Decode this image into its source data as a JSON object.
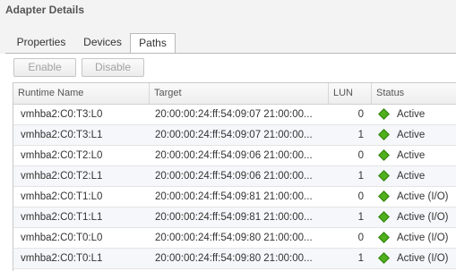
{
  "title": "Adapter Details",
  "tabs": [
    {
      "label": "Properties",
      "active": false
    },
    {
      "label": "Devices",
      "active": false
    },
    {
      "label": "Paths",
      "active": true
    }
  ],
  "toolbar": {
    "enable_label": "Enable",
    "disable_label": "Disable",
    "enabled": false
  },
  "grid": {
    "columns": [
      "Runtime Name",
      "Target",
      "LUN",
      "Status"
    ],
    "rows": [
      {
        "name": "vmhba2:C0:T3:L0",
        "target": "20:00:00:24:ff:54:09:07 21:00:00...",
        "lun": "0",
        "status": "Active"
      },
      {
        "name": "vmhba2:C0:T3:L1",
        "target": "20:00:00:24:ff:54:09:07 21:00:00...",
        "lun": "1",
        "status": "Active"
      },
      {
        "name": "vmhba2:C0:T2:L0",
        "target": "20:00:00:24:ff:54:09:06 21:00:00...",
        "lun": "0",
        "status": "Active"
      },
      {
        "name": "vmhba2:C0:T2:L1",
        "target": "20:00:00:24:ff:54:09:06 21:00:00...",
        "lun": "1",
        "status": "Active"
      },
      {
        "name": "vmhba2:C0:T1:L0",
        "target": "20:00:00:24:ff:54:09:81 21:00:00...",
        "lun": "0",
        "status": "Active (I/O)"
      },
      {
        "name": "vmhba2:C0:T1:L1",
        "target": "20:00:00:24:ff:54:09:81 21:00:00...",
        "lun": "1",
        "status": "Active (I/O)"
      },
      {
        "name": "vmhba2:C0:T0:L0",
        "target": "20:00:00:24:ff:54:09:80 21:00:00...",
        "lun": "0",
        "status": "Active (I/O)"
      },
      {
        "name": "vmhba2:C0:T0:L1",
        "target": "20:00:00:24:ff:54:09:80 21:00:00...",
        "lun": "1",
        "status": "Active (I/O)"
      }
    ]
  },
  "status_icon": "green-diamond-icon",
  "colors": {
    "status_active": "#4faf1c",
    "panel_bg": "#f3f3f3"
  }
}
